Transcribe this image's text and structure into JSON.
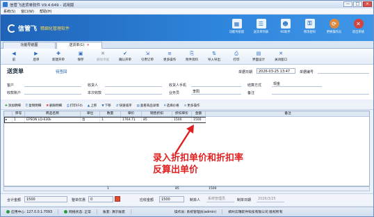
{
  "window": {
    "title": "信管飞送货单软件 V9.4.649 - 试用版",
    "min": "—",
    "max": "□",
    "close": "×"
  },
  "menu": [
    "系统(S)",
    "窗口(W)",
    "帮助(H)"
  ],
  "brand": {
    "name": "信管飞",
    "slogan": "精细化管理软件"
  },
  "top_tools": [
    {
      "label": "功能导航窗",
      "icon": "navigation-window-icon",
      "glyph": "▦"
    },
    {
      "label": "送货单列表",
      "icon": "delivery-list-icon",
      "glyph": "☰"
    },
    {
      "label": "KE助手",
      "icon": "ke-assistant-icon",
      "glyph": "☻"
    },
    {
      "label": "修改密码",
      "icon": "change-password-icon",
      "glyph": "⚿"
    },
    {
      "label": "更换操作员",
      "icon": "switch-operator-icon",
      "glyph": "⟳"
    },
    {
      "label": "退出系统",
      "icon": "exit-system-icon",
      "glyph": "✕"
    }
  ],
  "tabs": [
    {
      "label": "功能导航图"
    },
    {
      "label": "送货单(1)",
      "close": "×"
    }
  ],
  "toolbar": [
    {
      "label": "前",
      "icon": "prev-icon",
      "glyph": "◀",
      "disabled": false
    },
    {
      "label": "后单",
      "icon": "next-icon",
      "glyph": "▶",
      "disabled": false
    },
    {
      "label": "新建开单",
      "icon": "new-doc-icon",
      "glyph": "✚",
      "disabled": false
    },
    {
      "label": "保存",
      "icon": "save-icon",
      "glyph": "▣",
      "disabled": false
    },
    {
      "label": "删除单据",
      "icon": "delete-doc-icon",
      "glyph": "✖",
      "disabled": true
    },
    {
      "label": "确认开单",
      "icon": "confirm-doc-icon",
      "glyph": "✔",
      "disabled": false
    },
    {
      "label": "引用订单",
      "icon": "import-order-icon",
      "glyph": "⇲",
      "disabled": false
    },
    {
      "label": "更多操作",
      "icon": "more-actions-icon",
      "glyph": "≡",
      "disabled": false
    },
    {
      "label": "附件资料",
      "icon": "attachment-icon",
      "glyph": "⎘",
      "disabled": false
    },
    {
      "label": "导入导出",
      "icon": "import-export-icon",
      "glyph": "⇅",
      "disabled": false
    },
    {
      "label": "打印",
      "icon": "print-icon",
      "glyph": "⎙",
      "disabled": false
    },
    {
      "label": "界面设计",
      "icon": "layout-design-icon",
      "glyph": "▤",
      "disabled": false
    },
    {
      "label": "关闭窗口",
      "icon": "close-window-icon",
      "glyph": "✕",
      "disabled": false
    }
  ],
  "form": {
    "title": "送货单",
    "status": "待签回",
    "date_label": "单据日期",
    "date_value": "2026-03-25 13:47",
    "number_label": "单据编号",
    "number_value": "",
    "customer_label": "客户",
    "customer_value": "",
    "receiver_label": "收货人",
    "receiver_value": "",
    "receiver_phone_label": "收货人手机",
    "receiver_phone_value": "",
    "settle_label": "结算方式",
    "settle_value": "现金",
    "account_label": "收款账户",
    "account_value": "",
    "received_label": "本次收款",
    "received_value": "",
    "salesman_label": "业务员",
    "salesman_value": "李阳",
    "remark_label": "备注",
    "remark_value": ""
  },
  "grid_actions": [
    {
      "label": "添加明细",
      "icon": "add-row-icon",
      "glyph": "✚",
      "tone": "green"
    },
    {
      "label": "复制明细",
      "icon": "copy-row-icon",
      "glyph": "⎘",
      "tone": ""
    },
    {
      "label": "删除明细",
      "icon": "delete-row-icon",
      "glyph": "✖",
      "tone": "red"
    },
    {
      "label": "打印(F4)",
      "icon": "print-icon",
      "glyph": "⎙",
      "tone": ""
    },
    {
      "label": "上移",
      "icon": "move-up-icon",
      "glyph": "▲",
      "tone": ""
    },
    {
      "label": "下移",
      "icon": "move-down-icon",
      "glyph": "▼",
      "tone": ""
    },
    {
      "label": "快速排序",
      "icon": "sort-icon",
      "glyph": "⇵",
      "tone": ""
    },
    {
      "label": "查看商品详情",
      "icon": "product-detail-icon",
      "glyph": "▤",
      "tone": ""
    },
    {
      "label": "选择价格",
      "icon": "select-price-icon",
      "glyph": "¥",
      "tone": ""
    },
    {
      "label": "更多操作",
      "icon": "more-actions-icon",
      "glyph": "≡",
      "tone": ""
    }
  ],
  "grid": {
    "columns": [
      "序号",
      "商品名称",
      "单位",
      "数量",
      "单价",
      "销售折扣",
      "折扣单价",
      "金额",
      "备注"
    ],
    "rows": [
      {
        "marker": "▸",
        "no": "1",
        "name": "EPSON LQ-630k",
        "unit": "台",
        "qty": "1",
        "price": "1764.71",
        "discount": "85",
        "disc_price": "1500",
        "amount": "1500",
        "remark": ""
      }
    ]
  },
  "totals": {
    "qty": "1",
    "discount": "85",
    "amount": "1500"
  },
  "annotation": {
    "line1": "录入折扣单价和折扣率",
    "line2": "反算出单价"
  },
  "footer": {
    "total_label": "合计金额",
    "total_value": "1500",
    "discount_label": "整单优惠",
    "discount_value": "0",
    "receivable_label": "应收金额",
    "receivable_value": "1500",
    "maker_label": "制单人",
    "maker_value": "系统管理员",
    "make_date_label": "制单日期",
    "make_date_value": "2026/3/25"
  },
  "statusbar": {
    "center": "应用中心: 127.0.0.1:7093",
    "connection": "网络状态: 正常",
    "account": "账套: 演示账套",
    "operator": "操作员: 系统管理员(admin)",
    "company": "郑州云瑞软件科技有限公司  版权所有"
  }
}
